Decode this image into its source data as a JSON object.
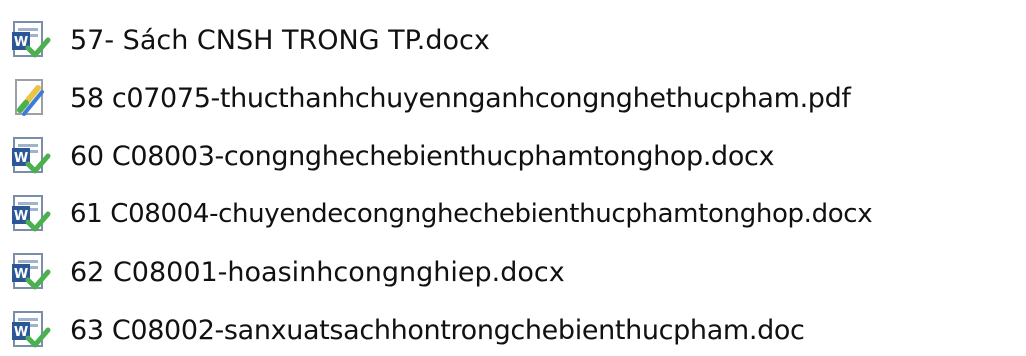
{
  "files": [
    {
      "name": "57- Sách CNSH TRONG TP.docx",
      "type": "word-document-icon"
    },
    {
      "name": "58 c07075-thucthanhchuyennganhcongnghethucpham.pdf",
      "type": "pdf-document-icon"
    },
    {
      "name": "60 C08003-congnghechebienthucphamtonghop.docx",
      "type": "word-document-icon"
    },
    {
      "name": "61 C08004-chuyendecongnghechebienthucphamtonghop.docx",
      "type": "word-document-icon"
    },
    {
      "name": "62 C08001-hoasinhcongnghiep.docx",
      "type": "word-document-icon"
    },
    {
      "name": "63 C08002-sanxuatsachhontrongchebienthucpham.doc",
      "type": "word-document-icon"
    }
  ],
  "colors": {
    "word_blue": "#2b5797",
    "check_green": "#4caf50",
    "pdf_yellow": "#e8c547",
    "text": "#111111"
  }
}
